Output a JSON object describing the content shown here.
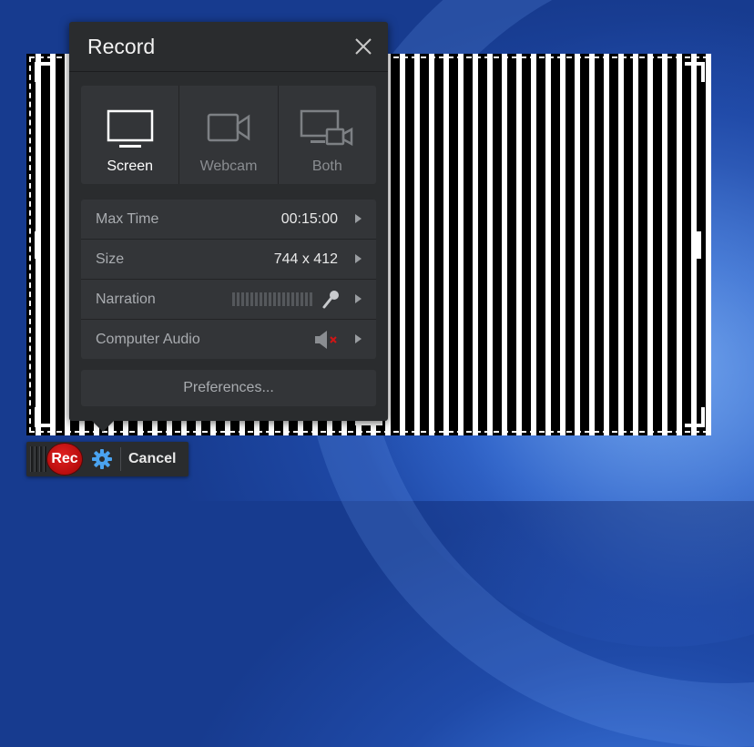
{
  "panel": {
    "title": "Record"
  },
  "sources": [
    {
      "label": "Screen",
      "icon": "monitor-icon",
      "active": true
    },
    {
      "label": "Webcam",
      "icon": "webcam-icon",
      "active": false
    },
    {
      "label": "Both",
      "icon": "monitor-webcam-icon",
      "active": false
    }
  ],
  "settings": {
    "max_time": {
      "label": "Max Time",
      "value": "00:15:00"
    },
    "size": {
      "label": "Size",
      "value": "744 x 412"
    },
    "narration": {
      "label": "Narration",
      "icon": "microphone-icon"
    },
    "computer_audio": {
      "label": "Computer Audio",
      "icon": "speaker-muted-icon"
    }
  },
  "preferences_label": "Preferences...",
  "toolbar": {
    "rec_label": "Rec",
    "cancel_label": "Cancel"
  },
  "colors": {
    "panel_bg": "#2a2c2e",
    "rec_red": "#d01515",
    "gear_blue": "#4aa3f0"
  }
}
